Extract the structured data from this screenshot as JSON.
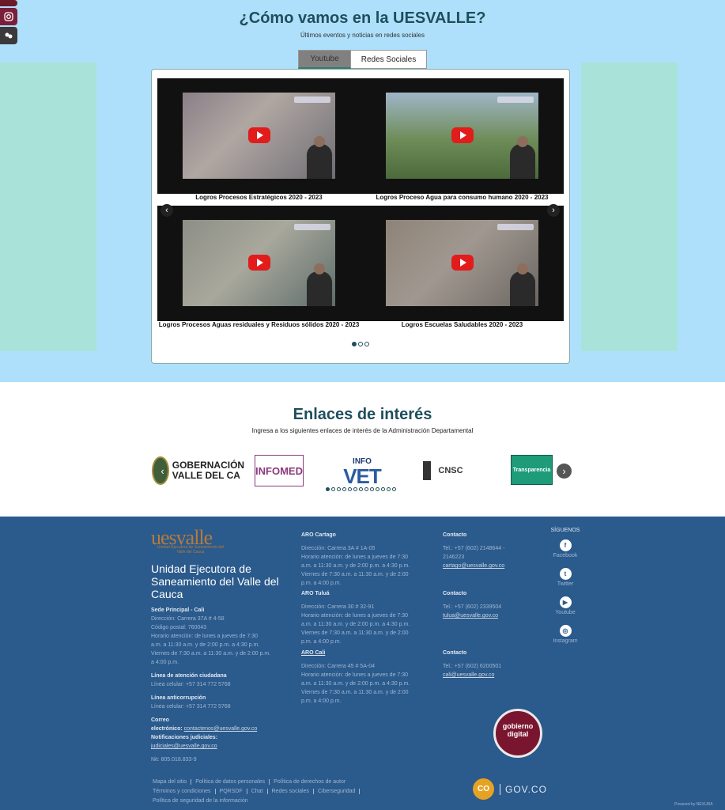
{
  "news": {
    "title": "¿Cómo vamos en la UESVALLE?",
    "subtitle": "Últimos eventos y noticias en redes sociales",
    "tabs": [
      "Youtube",
      "Redes Sociales"
    ],
    "videos": [
      "Logros Procesos Estratégicos 2020 - 2023",
      "Logros Proceso Agua para consumo humano 2020 - 2023",
      "Logros Procesos Aguas residuales y Residuos sólidos 2020 - 2023",
      "Logros Escuelas Saludables 2020 - 2023"
    ],
    "arrow_prev": "‹",
    "arrow_next": "›"
  },
  "links": {
    "title": "Enlaces de interés",
    "subtitle": "Ingresa a los siguientes enlaces de interés de la Administración Departamental",
    "logos": {
      "gob": "GOBERNACIÓN VALLE DEL CA",
      "inf": "INFOMED",
      "vet_top": "INFO",
      "vet_main": "VET",
      "cnsc": "CNSC",
      "tr": "Transparencia"
    },
    "arrow_prev": "‹",
    "arrow_next": "›"
  },
  "footer": {
    "brand": "uesvalle",
    "brand_sub": "Unidad Ejecutora de Saneamiento del Valle del Cauca",
    "org_name": "Unidad Ejecutora de Saneamiento del Valle del Cauca",
    "sede_title": "Sede Principal - Cali",
    "sede_lines": [
      "Dirección: Carrera 37A # 4-58",
      "Código postal: 760043",
      "Horario atención: de lunes a jueves de 7:30",
      "a.m. a 11:30 a.m. y de 2:00 p.m. a 4:30 p.m.",
      "Viernes de 7:30 a.m. a 11:30 a.m. y de 2:00 p.m.",
      "a 4:00 p.m."
    ],
    "atencion_title": "Línea de atención ciudadana",
    "atencion_line": "Línea celular: +57 314 772 5768",
    "anticorr_title": "Línea anticorrupción",
    "anticorr_line": "Línea celular: +57 314 772 5768",
    "correo_label": "Correo",
    "correo_label2": "electrónico:",
    "correo_value": "contactenos@uesvalle.gov.co",
    "notif_label": "Notificaciones judiciales:",
    "notif_value": "judiciales@uesvalle.gov.co",
    "nit": "Nit: 805.018.833-9",
    "aro_cartago_title": "ARO Cartago",
    "aro_cartago_lines": [
      "Dirección: Carrera 3A # 1A-05",
      "Horario atención: de lunes a jueves de 7:30",
      "a.m. a 11:30 a.m. y de 2:00 p.m. a 4:30 p.m.",
      "Viernes de 7:30 a.m. a 11:30 a.m. y de 2:00",
      "p.m. a 4:00 p.m."
    ],
    "aro_tulua_title": "ARO Tuluá",
    "aro_tulua_lines": [
      "Dirección: Carrera 30 # 32-91",
      "Horario atención: de lunes a jueves de 7:30",
      "a.m. a 11:30 a.m. y de 2:00 p.m. a 4:30 p.m.",
      "Viernes de 7:30 a.m. a 11:30 a.m. y de 2:00",
      "p.m. a 4:00 p.m."
    ],
    "aro_cali_title": "ARO Cali",
    "aro_cali_lines": [
      "Dirección: Carrera 45 # 5A-04",
      "Horario atención: de lunes a jueves de 7:30",
      "a.m. a 11:30 a.m. y de 2:00 p.m. a 4:30 p.m.",
      "Viernes de 7:30 a.m. a 11:30 a.m. y de 2:00",
      "p.m. a 4:00 p.m."
    ],
    "contact_title": "Contacto",
    "contact_cartago_tel": "Tel.: +57 (602) 2148644 -",
    "contact_cartago_tel2": "2146223",
    "contact_cartago_mail": "cartago@uesvalle.gov.co",
    "contact_tulua_tel": "Tel.: +57 (602) 2339504",
    "contact_tulua_mail": "tulua@uesvalle.gov.co",
    "contact_cali_tel": "Tel.: +57 (602) 6200501",
    "contact_cali_mail": "cali@uesvalle.gov.co",
    "social_title": "SÍGUENOS",
    "social": [
      {
        "label": "Facebook",
        "glyph": "f"
      },
      {
        "label": "Twitter",
        "glyph": "t"
      },
      {
        "label": "Youtube",
        "glyph": "▶"
      },
      {
        "label": "Instagram",
        "glyph": "◎"
      }
    ],
    "seal_text": "Sello gobierno digital Colombia",
    "bottom_row1": [
      "Mapa del sitio",
      "Política de datos personales",
      "Política de derechos de autor"
    ],
    "bottom_row2": [
      "Términos y condiciones",
      "PQRSDF",
      "Chat",
      "Redes sociales",
      "Ciberseguridad"
    ],
    "bottom_row3": "Política de seguridad de la información",
    "co_badge": "CO",
    "gov_text": "GOV.CO",
    "powered": "Powered by NEXURA"
  }
}
